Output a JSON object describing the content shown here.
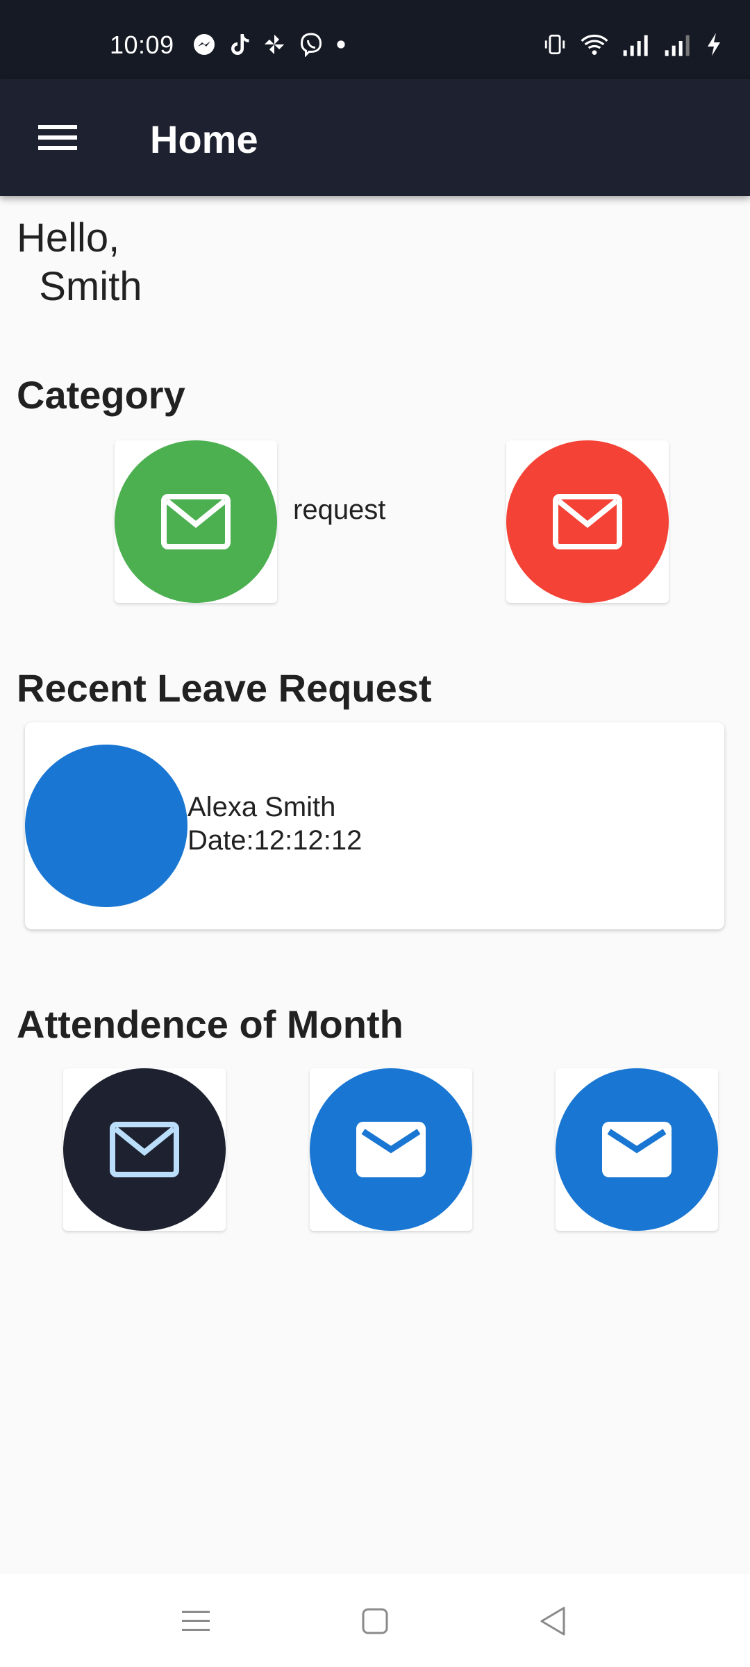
{
  "status_bar": {
    "time": "10:09",
    "left_icons": [
      "messenger-icon",
      "tiktok-icon",
      "pinwheel-icon",
      "viber-icon",
      "dot-icon"
    ],
    "right_icons": [
      "vibrate-icon",
      "wifi-icon",
      "signal-icon",
      "signal-icon",
      "charging-icon"
    ]
  },
  "app_bar": {
    "title": "Home",
    "menu_icon": "hamburger-menu-icon"
  },
  "greeting": {
    "text": "Hello,\n  Smith"
  },
  "category": {
    "title": "Category",
    "label": "request",
    "items": [
      {
        "icon": "mail-icon",
        "color": "#4caf50"
      },
      {
        "icon": "mail-icon",
        "color": "#f44336"
      }
    ]
  },
  "recent_leave": {
    "title": "Recent Leave Request",
    "name": "Alexa Smith",
    "date": "Date:12:12:12",
    "avatar_color": "#1976d2"
  },
  "attendance": {
    "title": "Attendence of Month",
    "items": [
      {
        "icon": "mail-icon",
        "color": "#1e2230",
        "icon_color": "#bbdefb"
      },
      {
        "icon": "mail-icon",
        "color": "#1976d2",
        "icon_color": "#ffffff"
      },
      {
        "icon": "mail-icon",
        "color": "#1976d2",
        "icon_color": "#ffffff"
      }
    ]
  },
  "nav_bar": {
    "icons": [
      "recents-icon",
      "home-icon",
      "back-icon"
    ]
  }
}
